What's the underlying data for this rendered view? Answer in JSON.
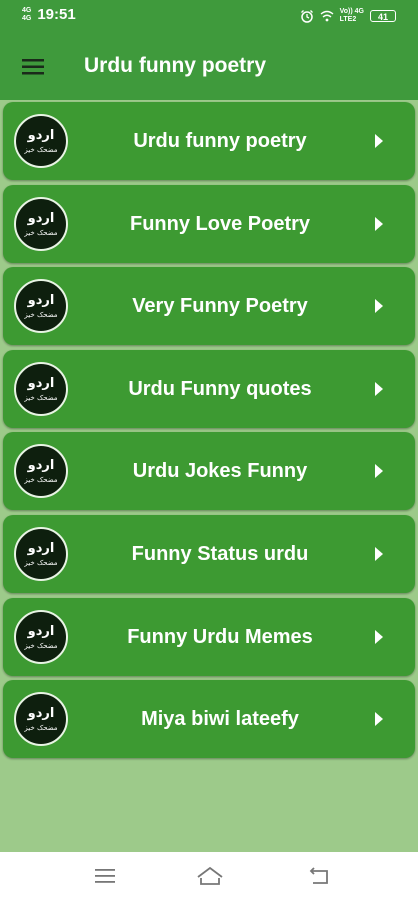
{
  "status_bar": {
    "network_left_top": "4G",
    "network_left_bottom": "4G",
    "time": "19:51",
    "network_right_top": "Vo)) 4G",
    "network_right_bottom": "LTE2",
    "battery": "41",
    "icons": [
      "alarm-icon",
      "wifi-signal-icon"
    ]
  },
  "app_bar": {
    "title": "Urdu funny poetry",
    "menu_icon": "hamburger-menu-icon"
  },
  "colors": {
    "primary": "#3f9a3c",
    "card": "#3d9a32",
    "background": "#9dca8a",
    "logo_bg": "#0e1f0e"
  },
  "logo": {
    "line1": "اردو",
    "line2": "مضحک خیز"
  },
  "menu_items": [
    {
      "label": "Urdu funny poetry"
    },
    {
      "label": "Funny Love Poetry"
    },
    {
      "label": "Very Funny Poetry"
    },
    {
      "label": "Urdu Funny quotes"
    },
    {
      "label": "Urdu Jokes Funny"
    },
    {
      "label": "Funny Status urdu"
    },
    {
      "label": "Funny Urdu Memes"
    },
    {
      "label": "Miya biwi lateefy"
    }
  ],
  "nav_bar": {
    "icons": [
      "recent-apps-icon",
      "home-icon",
      "back-icon"
    ]
  }
}
